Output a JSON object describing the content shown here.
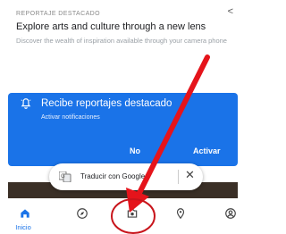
{
  "card": {
    "eyebrow": "REPORTAJE DESTACADO",
    "title": "Explore arts and culture through a new lens",
    "subtitle": "Discover the wealth of inspiration available through your camera phone",
    "share_icon": "share-icon"
  },
  "banner": {
    "title": "Recibe reportajes destacado",
    "subtitle": "Activar notificaciones",
    "dismiss_label": "No",
    "activate_label": "Activar",
    "bell_icon": "bell-icon",
    "color": "#1a73e8"
  },
  "translate_chip": {
    "label": "Traducir con Google",
    "icon": "google-translate-icon",
    "close_icon": "close-icon"
  },
  "bottom_nav": {
    "items": [
      {
        "label": "Inicio",
        "icon": "home-icon",
        "active": true
      },
      {
        "label": "",
        "icon": "explore-icon",
        "active": false
      },
      {
        "label": "",
        "icon": "camera-icon",
        "active": false
      },
      {
        "label": "",
        "icon": "location-icon",
        "active": false
      },
      {
        "label": "",
        "icon": "profile-icon",
        "active": false
      }
    ],
    "accent": "#1a73e8"
  },
  "annotation": {
    "arrow_color": "#e5141b",
    "circle_color": "#c8141b"
  }
}
